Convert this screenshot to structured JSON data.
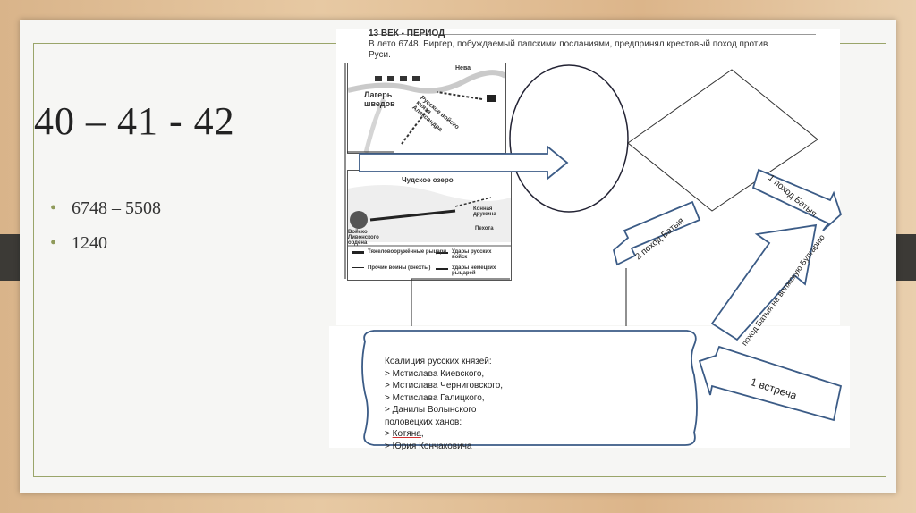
{
  "slide": {
    "title": "40 – 41 - 42",
    "bullets": [
      "6748 – 5508",
      "1240"
    ]
  },
  "worksheet": {
    "header": "13  ВЕК -  ПЕРИОД",
    "intro": "В лето 6748. Биргер, побуждаемый папскими посланиями, предпринял крестовый поход против Руси.",
    "map1_labels": {
      "river": "Нева",
      "camp": "Лагерь шведов",
      "army": "Русское войско князя Александра"
    },
    "map2_labels": {
      "lake": "Чудское озеро",
      "order": "Войско Ливонского ордена",
      "legend1": "Тяжеловооружённые рыцари",
      "legend2": "Удары русских войск",
      "legend3": "Прочие воины (кнехты)",
      "legend4": "Удары немецких рыцарей",
      "cavalry": "Конная дружина",
      "infantry": "Пехота"
    },
    "arrows": {
      "batu1": "1 поход Батыя",
      "batu2": "2 поход Батыя",
      "batu_volga": "поход Батыя на волжскую Булгарию",
      "meeting": "1 встреча"
    },
    "coalition": {
      "heading": "Коалиция  русских князей:",
      "items": [
        "> Мстислава Киевского,",
        "> Мстислава Черниговского,",
        "> Мстислава Галицкого,",
        "> Данилы Волынского"
      ],
      "subheading": "половецких ханов:",
      "khan1_prefix": "> ",
      "khan1": "Котяна",
      "khan1_suffix": ",",
      "khan2_prefix": "> Юрия ",
      "khan2": "Кончаковича"
    }
  }
}
